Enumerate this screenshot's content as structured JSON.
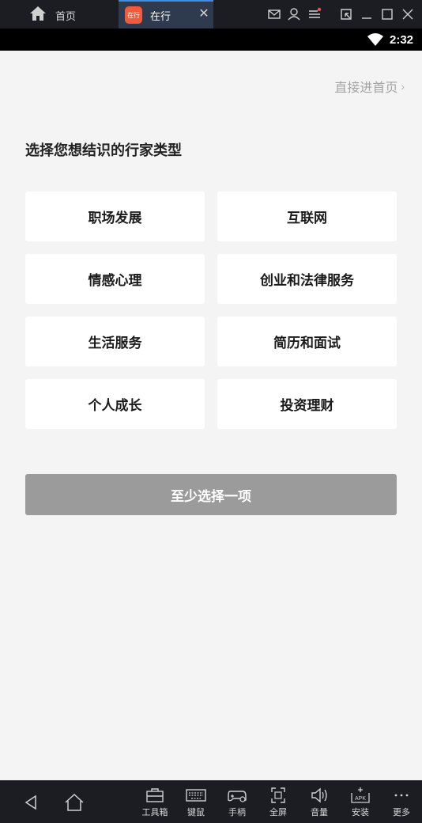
{
  "topbar": {
    "home_tab_label": "首页",
    "app_tab_label": "在行",
    "app_icon_text": "在行"
  },
  "statusbar": {
    "time": "2:32"
  },
  "page": {
    "skip_label": "直接进首页",
    "heading": "选择您想结识的行家类型",
    "options": [
      "职场发展",
      "互联网",
      "情感心理",
      "创业和法律服务",
      "生活服务",
      "简历和面试",
      "个人成长",
      "投资理财"
    ],
    "submit_label": "至少选择一项"
  },
  "toolbar": {
    "tools": [
      "工具箱",
      "键鼠",
      "手柄",
      "全屏",
      "音量",
      "安装",
      "更多"
    ]
  },
  "colors": {
    "accent": "#3a8ee6",
    "app_icon": "#f15a3a",
    "button_disabled": "#9b9b9b"
  }
}
